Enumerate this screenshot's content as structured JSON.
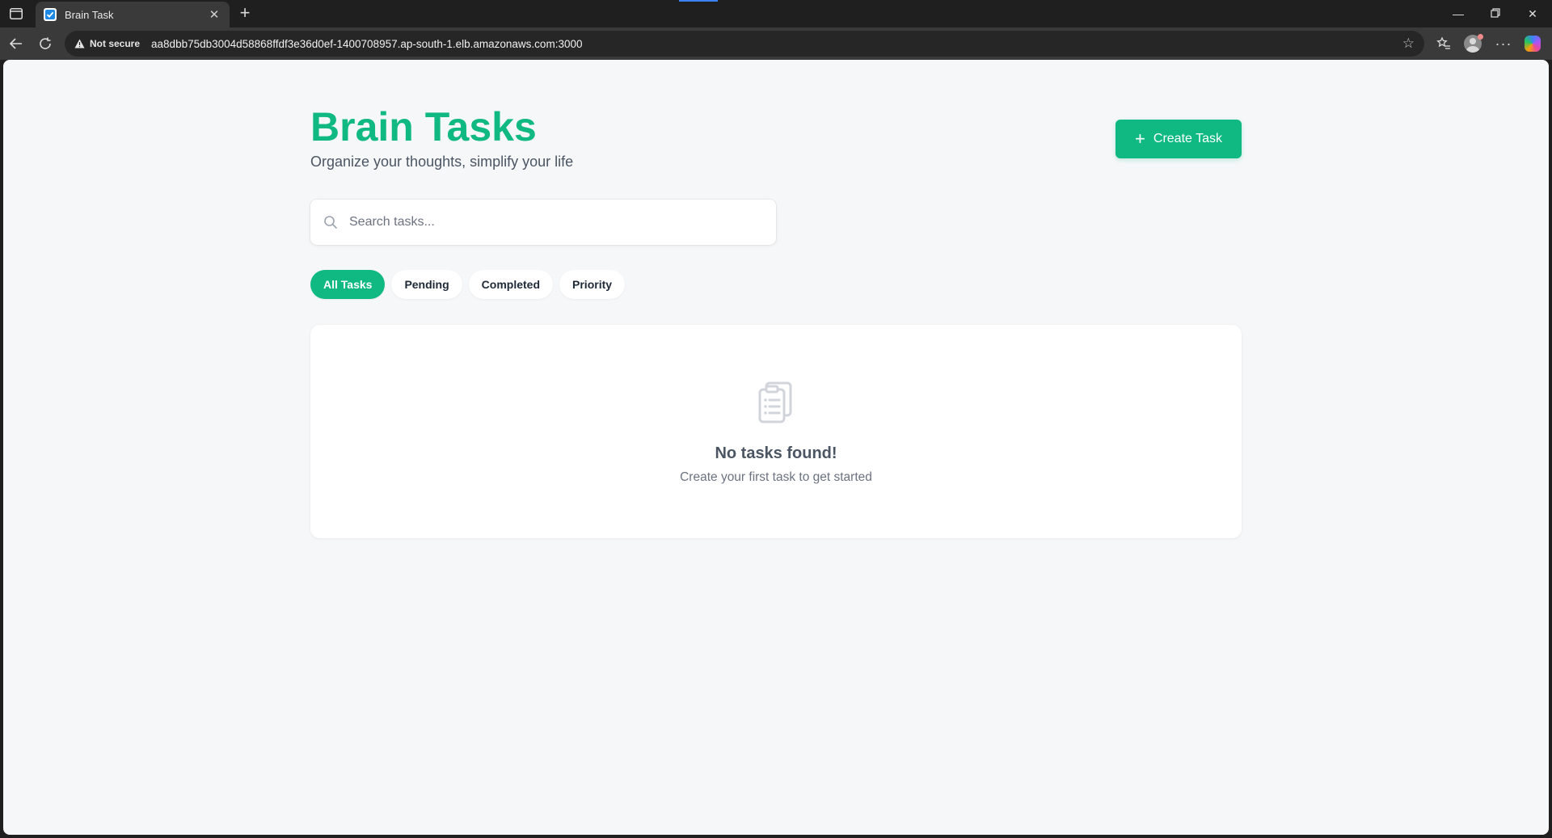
{
  "browser": {
    "tab_title": "Brain Task",
    "security_label": "Not secure",
    "url": "aa8dbb75db3004d58868ffdf3e36d0ef-1400708957.ap-south-1.elb.amazonaws.com:3000",
    "icons": [
      "sidebar-icon",
      "close-icon",
      "plus-icon",
      "back-icon",
      "reload-icon",
      "warning-icon",
      "star-icon",
      "favorites-icon",
      "profile-avatar",
      "more-icon",
      "copilot-icon",
      "minimize-icon",
      "restore-icon",
      "close-window-icon"
    ]
  },
  "header": {
    "title": "Brain Tasks",
    "subtitle": "Organize your thoughts, simplify your life",
    "create_button_label": "Create Task"
  },
  "search": {
    "placeholder": "Search tasks..."
  },
  "filters": [
    {
      "label": "All Tasks",
      "active": true
    },
    {
      "label": "Pending",
      "active": false
    },
    {
      "label": "Completed",
      "active": false
    },
    {
      "label": "Priority",
      "active": false
    }
  ],
  "empty_state": {
    "title": "No tasks found!",
    "message": "Create your first task to get started"
  },
  "colors": {
    "brand": "#10b981",
    "background": "#f6f7f9",
    "text_muted": "#6b7280"
  }
}
